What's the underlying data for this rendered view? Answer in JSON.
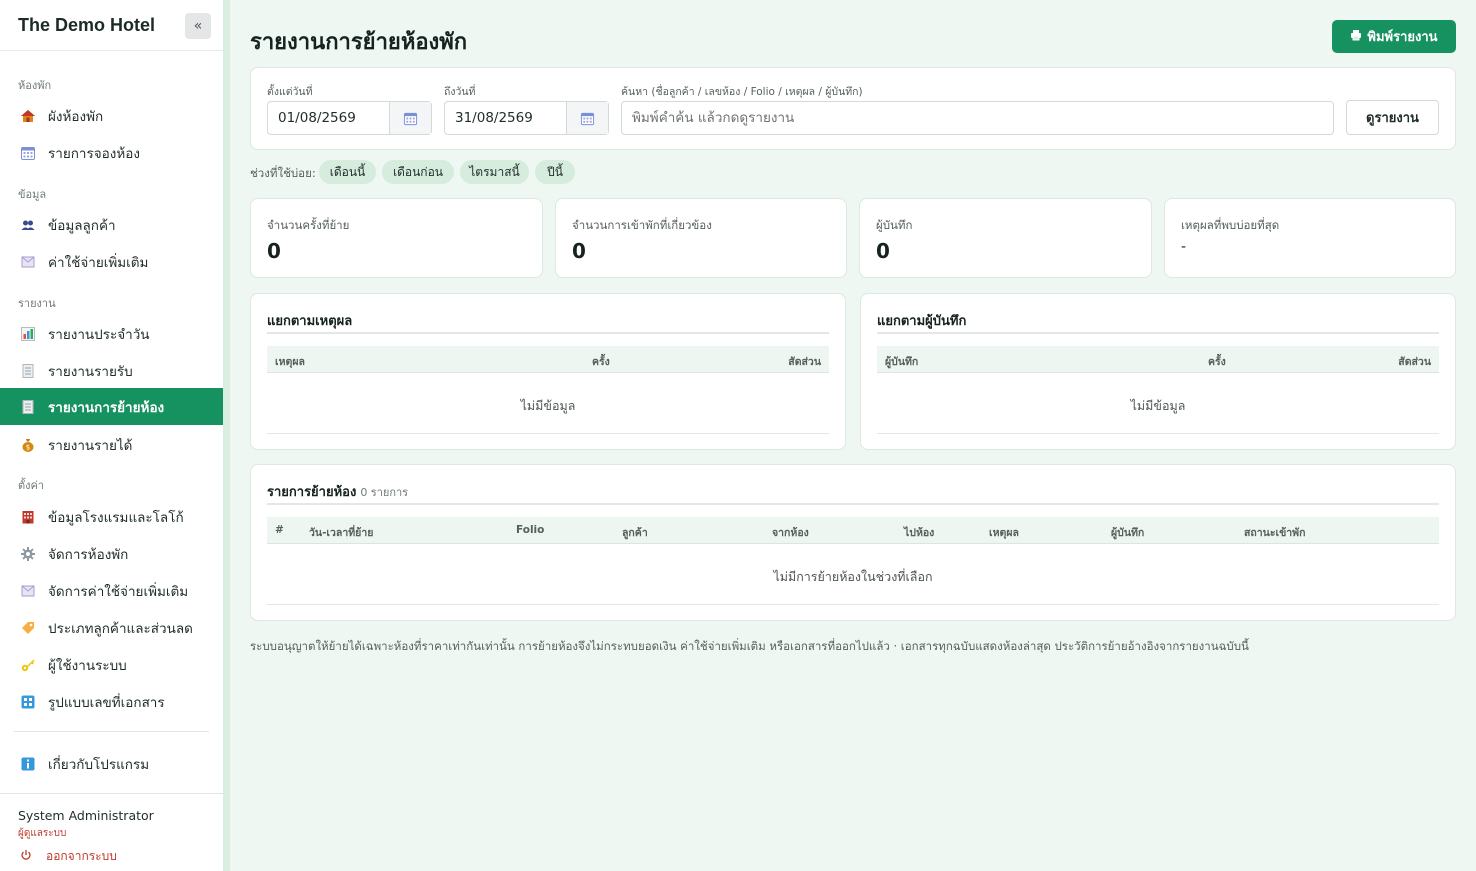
{
  "app": {
    "brand": "The Demo Hotel",
    "collapse_icon": "«"
  },
  "sidebar": {
    "sections": {
      "rooms": "ห้องพัก",
      "data": "ข้อมูล",
      "reports": "รายงาน",
      "settings": "ตั้งค่า"
    },
    "items": [
      {
        "label": "ผังห้องพัก",
        "icon": "house-icon"
      },
      {
        "label": "รายการจองห้อง",
        "icon": "calendar-icon"
      },
      {
        "label": "ข้อมูลลูกค้า",
        "icon": "people-icon"
      },
      {
        "label": "ค่าใช้จ่ายเพิ่มเติม",
        "icon": "receipt-icon"
      },
      {
        "label": "รายงานประจำวัน",
        "icon": "bar-chart-icon"
      },
      {
        "label": "รายงานรายรับ",
        "icon": "document-icon"
      },
      {
        "label": "รายงานการย้ายห้อง",
        "icon": "document-icon",
        "active": true
      },
      {
        "label": "รายงานรายได้",
        "icon": "money-bag-icon"
      },
      {
        "label": "ข้อมูลโรงแรมและโลโก้",
        "icon": "building-icon"
      },
      {
        "label": "จัดการห้องพัก",
        "icon": "gear-icon"
      },
      {
        "label": "จัดการค่าใช้จ่ายเพิ่มเติม",
        "icon": "receipt-icon"
      },
      {
        "label": "ประเภทลูกค้าและส่วนลด",
        "icon": "tag-icon"
      },
      {
        "label": "ผู้ใช้งานระบบ",
        "icon": "key-icon"
      },
      {
        "label": "รูปแบบเลขที่เอกสาร",
        "icon": "numbers-icon"
      },
      {
        "label": "เกี่ยวกับโปรแกรม",
        "icon": "info-icon"
      }
    ],
    "user": {
      "name": "System Administrator",
      "role": "ผู้ดูแลระบบ",
      "logout": "ออกจากระบบ"
    }
  },
  "page": {
    "title": "รายงานการย้ายห้องพัก",
    "print_button": "พิมพ์รายงาน"
  },
  "filters": {
    "from_label": "ตั้งแต่วันที่",
    "from_value": "01/08/2569",
    "to_label": "ถึงวันที่",
    "to_value": "31/08/2569",
    "search_label": "ค้นหา (ชื่อลูกค้า / เลขห้อง / Folio / เหตุผล / ผู้บันทึก)",
    "search_placeholder": "พิมพ์คำค้น แล้วกดดูรายงาน",
    "search_value": "",
    "view_button": "ดูรายงาน",
    "quick_label": "ช่วงที่ใช้บ่อย:",
    "quick_ranges": [
      "เดือนนี้",
      "เดือนก่อน",
      "ไตรมาสนี้",
      "ปีนี้"
    ]
  },
  "stats": [
    {
      "label": "จำนวนครั้งที่ย้าย",
      "value": "0"
    },
    {
      "label": "จำนวนการเข้าพักที่เกี่ยวข้อง",
      "value": "0"
    },
    {
      "label": "ผู้บันทึก",
      "value": "0"
    },
    {
      "label": "เหตุผลที่พบบ่อยที่สุด",
      "value": "-"
    }
  ],
  "by_reason": {
    "title": "แยกตามเหตุผล",
    "columns": [
      "เหตุผล",
      "ครั้ง",
      "สัดส่วน"
    ],
    "empty": "ไม่มีข้อมูล"
  },
  "by_recorder": {
    "title": "แยกตามผู้บันทึก",
    "columns": [
      "ผู้บันทึก",
      "ครั้ง",
      "สัดส่วน"
    ],
    "empty": "ไม่มีข้อมูล"
  },
  "moves": {
    "title": "รายการย้ายห้อง",
    "count": "0 รายการ",
    "columns": [
      "#",
      "วัน-เวลาที่ย้าย",
      "Folio",
      "ลูกค้า",
      "จากห้อง",
      "ไปห้อง",
      "เหตุผล",
      "ผู้บันทึก",
      "สถานะเข้าพัก"
    ],
    "empty": "ไม่มีการย้ายห้องในช่วงที่เลือก"
  },
  "footnote": "ระบบอนุญาตให้ย้ายได้เฉพาะห้องที่ราคาเท่ากันเท่านั้น การย้ายห้องจึงไม่กระทบยอดเงิน ค่าใช้จ่ายเพิ่มเติม หรือเอกสารที่ออกไปแล้ว · เอกสารทุกฉบับแสดงห้องล่าสุด ประวัติการย้ายอ้างอิงจากรายงานฉบับนี้",
  "colors": {
    "accent": "#169160",
    "background": "#eef7f1",
    "danger": "#c0392b",
    "chip": "#d6ecdd"
  }
}
